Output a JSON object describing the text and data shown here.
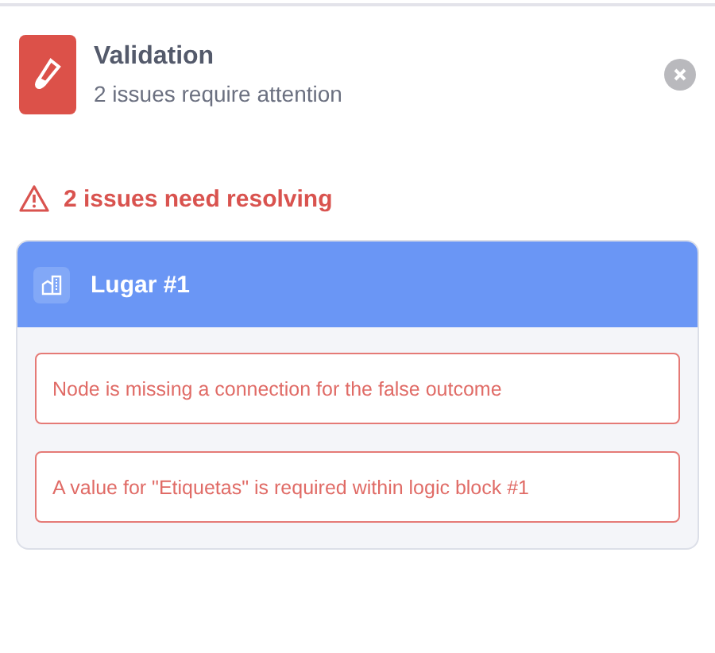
{
  "header": {
    "title": "Validation",
    "subtitle": "2 issues require attention"
  },
  "summary": {
    "text": "2 issues need resolving"
  },
  "groups": [
    {
      "title": "Lugar #1",
      "issues": [
        {
          "text": "Node is missing a connection for the false outcome"
        },
        {
          "text": "A value for \"Etiquetas\" is required within logic block #1"
        }
      ]
    }
  ]
}
